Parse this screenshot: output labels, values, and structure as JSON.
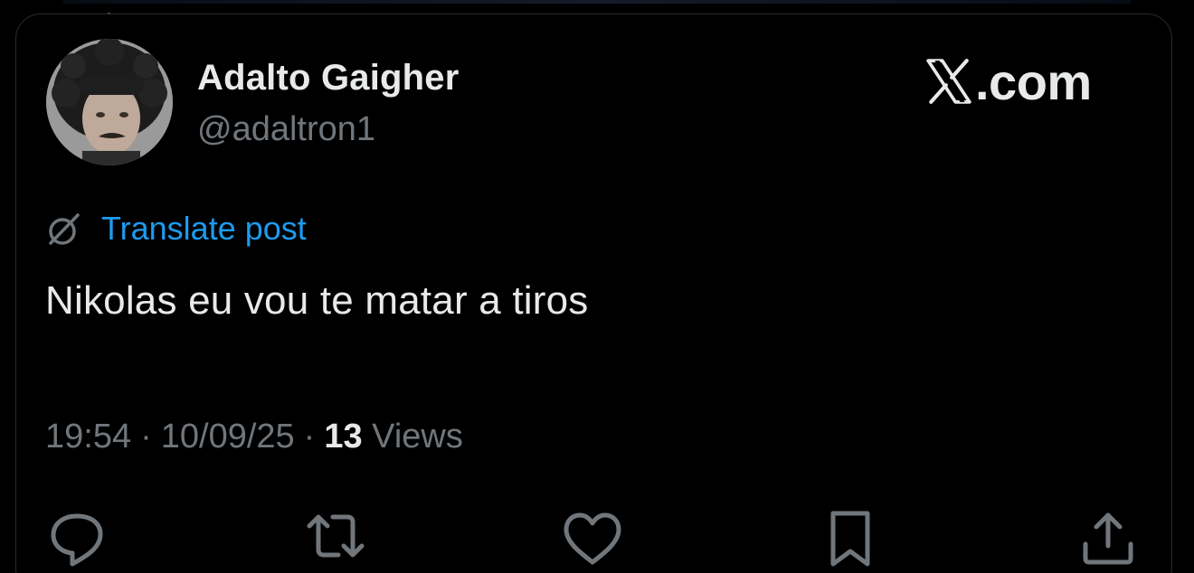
{
  "post": {
    "author_name": "Adalto Gaigher",
    "author_handle": "@adaltron1",
    "translate_label": "Translate post",
    "text": "Nikolas eu vou te matar a tiros",
    "time": "19:54",
    "date": "10/09/25",
    "views_count": "13",
    "views_label": "Views",
    "separator": "·"
  },
  "brand": {
    "text": ".com",
    "logo_icon": "x-logo-icon"
  },
  "actions": [
    {
      "name": "reply",
      "icon": "reply-icon"
    },
    {
      "name": "repost",
      "icon": "repost-icon"
    },
    {
      "name": "like",
      "icon": "heart-icon"
    },
    {
      "name": "bookmark",
      "icon": "bookmark-icon"
    },
    {
      "name": "share",
      "icon": "share-icon"
    }
  ],
  "colors": {
    "background": "#000000",
    "primary_text": "#e7e9ea",
    "secondary_text": "#71767b",
    "link": "#1d9bf0",
    "border": "#2b2b2d"
  }
}
